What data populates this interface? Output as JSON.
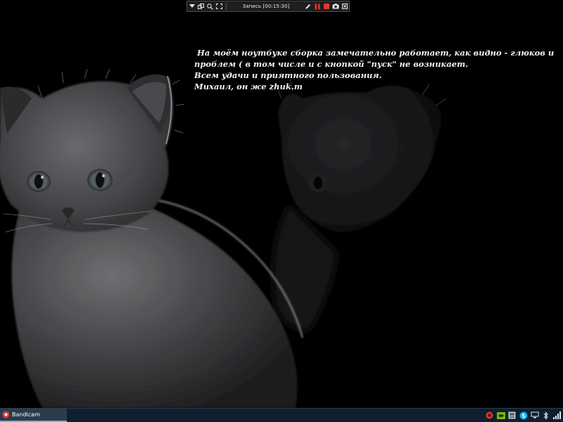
{
  "recorder": {
    "status": "Запись [00:15:30]",
    "icons": [
      "menu-arrow-icon",
      "window-mode-icon",
      "search-icon",
      "fullscreen-icon",
      "pencil-icon",
      "pause-icon",
      "stop-icon",
      "camera-icon",
      "close-icon"
    ],
    "accent": "#e0392f"
  },
  "note": {
    "lines": [
      " На моём ноутбуке сборка замечательно работает, как видно - глюков и",
      "проблем ( в том числе и с кнопкой \"пуск\" не возникает.",
      "Всем удачи и приятного пользования.",
      "Михаил, он же zhuk.m"
    ],
    "color": "#f2f2f2"
  },
  "taskbar": {
    "app_label": "Bandicam",
    "app_icon": "bandicam-icon",
    "tray_icons": [
      "record-icon",
      "nvidia-icon",
      "tray-app-icon",
      "skype-icon",
      "network-icon",
      "bluetooth-icon",
      "signal-icon"
    ],
    "background": "#0f1f2e"
  }
}
